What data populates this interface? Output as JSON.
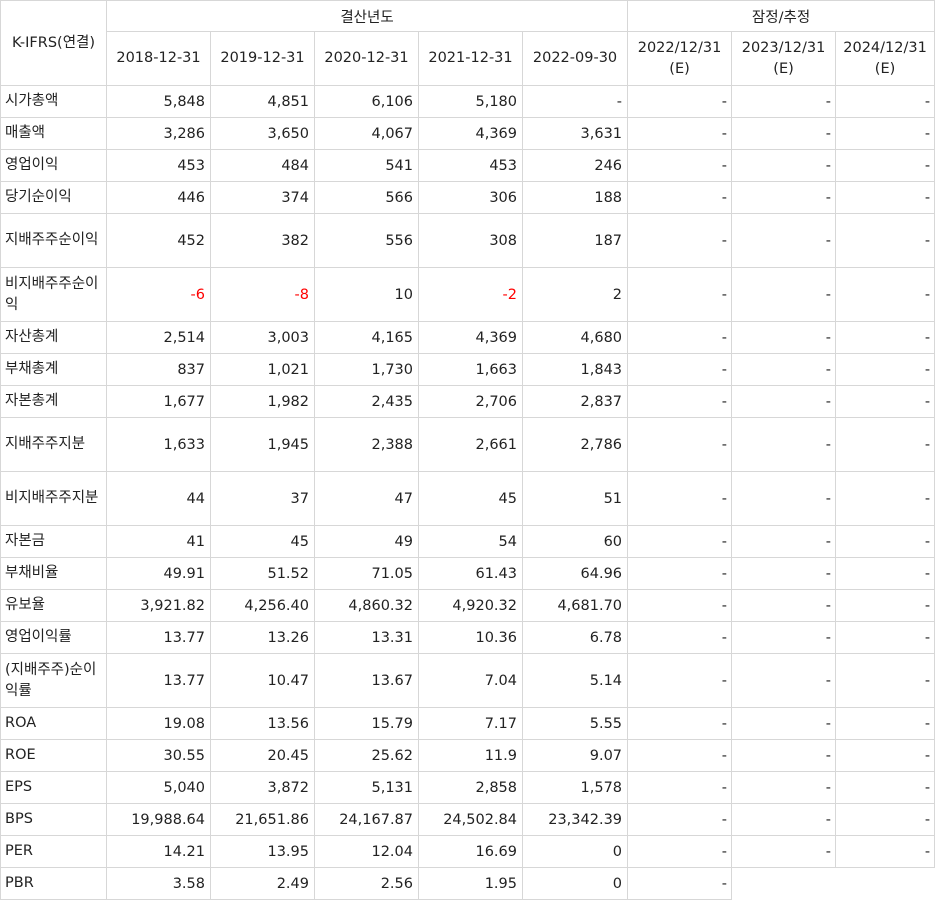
{
  "header": {
    "corner": "K-IFRS(연결)",
    "group_actual": "결산년도",
    "group_estimate": "잠정/추정",
    "actual_years": [
      "2018-12-31",
      "2019-12-31",
      "2020-12-31",
      "2021-12-31",
      "2022-09-30"
    ],
    "estimate_years": [
      "2022/12/31 (E)",
      "2023/12/31 (E)",
      "2024/12/31 (E)"
    ]
  },
  "rows": [
    {
      "label": "시가총액",
      "values": [
        "5,848",
        "4,851",
        "6,106",
        "5,180",
        "-"
      ],
      "est": [
        "-",
        "-",
        "-"
      ]
    },
    {
      "label": "매출액",
      "values": [
        "3,286",
        "3,650",
        "4,067",
        "4,369",
        "3,631"
      ],
      "est": [
        "-",
        "-",
        "-"
      ]
    },
    {
      "label": "영업이익",
      "values": [
        "453",
        "484",
        "541",
        "453",
        "246"
      ],
      "est": [
        "-",
        "-",
        "-"
      ]
    },
    {
      "label": "당기순이익",
      "values": [
        "446",
        "374",
        "566",
        "306",
        "188"
      ],
      "est": [
        "-",
        "-",
        "-"
      ]
    },
    {
      "label": " 지배주주순이익",
      "values": [
        "452",
        "382",
        "556",
        "308",
        "187"
      ],
      "est": [
        "-",
        "-",
        "-"
      ],
      "tall": true
    },
    {
      "label": " 비지배주주순이익",
      "values": [
        "-6",
        "-8",
        "10",
        "-2",
        "2"
      ],
      "est": [
        "-",
        "-",
        "-"
      ],
      "tall": true
    },
    {
      "label": "자산총계",
      "values": [
        "2,514",
        "3,003",
        "4,165",
        "4,369",
        "4,680"
      ],
      "est": [
        "-",
        "-",
        "-"
      ]
    },
    {
      "label": "부채총계",
      "values": [
        "837",
        "1,021",
        "1,730",
        "1,663",
        "1,843"
      ],
      "est": [
        "-",
        "-",
        "-"
      ]
    },
    {
      "label": "자본총계",
      "values": [
        "1,677",
        "1,982",
        "2,435",
        "2,706",
        "2,837"
      ],
      "est": [
        "-",
        "-",
        "-"
      ]
    },
    {
      "label": " 지배주주지분",
      "values": [
        "1,633",
        "1,945",
        "2,388",
        "2,661",
        "2,786"
      ],
      "est": [
        "-",
        "-",
        "-"
      ],
      "tall": true
    },
    {
      "label": " 비지배주주지분",
      "values": [
        "44",
        "37",
        "47",
        "45",
        "51"
      ],
      "est": [
        "-",
        "-",
        "-"
      ],
      "tall": true
    },
    {
      "label": "자본금",
      "values": [
        "41",
        "45",
        "49",
        "54",
        "60"
      ],
      "est": [
        "-",
        "-",
        "-"
      ]
    },
    {
      "label": "부채비율",
      "values": [
        "49.91",
        "51.52",
        "71.05",
        "61.43",
        "64.96"
      ],
      "est": [
        "-",
        "-",
        "-"
      ]
    },
    {
      "label": "유보율",
      "values": [
        "3,921.82",
        "4,256.40",
        "4,860.32",
        "4,920.32",
        "4,681.70"
      ],
      "est": [
        "-",
        "-",
        "-"
      ]
    },
    {
      "label": "영업이익률",
      "values": [
        "13.77",
        "13.26",
        "13.31",
        "10.36",
        "6.78"
      ],
      "est": [
        "-",
        "-",
        "-"
      ]
    },
    {
      "label": "(지배주주)순이익률",
      "values": [
        "13.77",
        "10.47",
        "13.67",
        "7.04",
        "5.14"
      ],
      "est": [
        "-",
        "-",
        "-"
      ],
      "tall": true
    },
    {
      "label": "ROA",
      "values": [
        "19.08",
        "13.56",
        "15.79",
        "7.17",
        "5.55"
      ],
      "est": [
        "-",
        "-",
        "-"
      ]
    },
    {
      "label": "ROE",
      "values": [
        "30.55",
        "20.45",
        "25.62",
        "11.9",
        "9.07"
      ],
      "est": [
        "-",
        "-",
        "-"
      ]
    },
    {
      "label": "EPS",
      "values": [
        "5,040",
        "3,872",
        "5,131",
        "2,858",
        "1,578"
      ],
      "est": [
        "-",
        "-",
        "-"
      ]
    },
    {
      "label": "BPS",
      "values": [
        "19,988.64",
        "21,651.86",
        "24,167.87",
        "24,502.84",
        "23,342.39"
      ],
      "est": [
        "-",
        "-",
        "-"
      ]
    },
    {
      "label": "PER",
      "values": [
        "14.21",
        "13.95",
        "12.04",
        "16.69",
        "0"
      ],
      "est": [
        "-",
        "-",
        "-"
      ]
    },
    {
      "label": "PBR",
      "values": [
        "3.58",
        "2.49",
        "2.56",
        "1.95",
        "0"
      ],
      "est": [
        "-"
      ]
    }
  ]
}
